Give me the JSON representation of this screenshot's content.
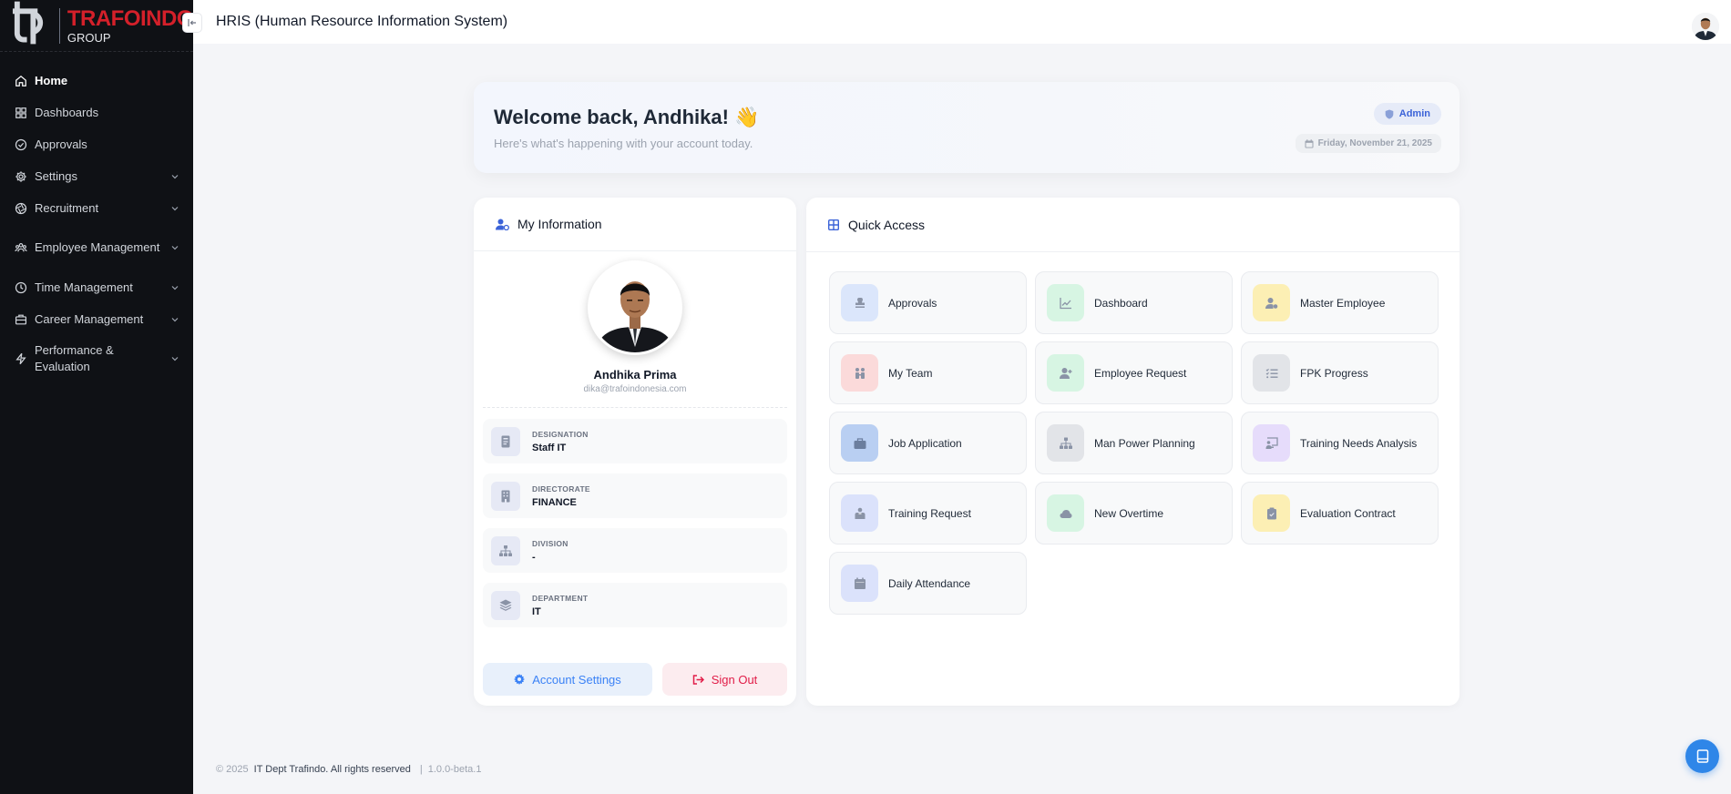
{
  "brand": {
    "name": "TRAFOINDO",
    "sub": "GROUP"
  },
  "header": {
    "title": "HRIS (Human Resource Information System)"
  },
  "sidebar": {
    "items": [
      {
        "label": "Home",
        "icon": "home-icon",
        "active": true,
        "expandable": false
      },
      {
        "label": "Dashboards",
        "icon": "grid-icon",
        "active": false,
        "expandable": false
      },
      {
        "label": "Approvals",
        "icon": "check-circle-icon",
        "active": false,
        "expandable": false
      },
      {
        "label": "Settings",
        "icon": "gear-icon",
        "active": false,
        "expandable": true
      },
      {
        "label": "Recruitment",
        "icon": "aperture-icon",
        "active": false,
        "expandable": true
      },
      {
        "label": "Employee Management",
        "icon": "users-icon",
        "active": false,
        "expandable": true
      },
      {
        "label": "Time Management",
        "icon": "clock-icon",
        "active": false,
        "expandable": true
      },
      {
        "label": "Career Management",
        "icon": "briefcase-icon",
        "active": false,
        "expandable": true
      },
      {
        "label": "Performance & Evaluation",
        "icon": "lightning-icon",
        "active": false,
        "expandable": true
      }
    ]
  },
  "welcome": {
    "title": "Welcome back, Andhika! 👋",
    "subtitle": "Here's what's happening with your account today.",
    "role": "Admin",
    "date": "Friday, November 21, 2025"
  },
  "my_info": {
    "title": "My Information",
    "name": "Andhika Prima",
    "email": "dika@trafoindonesia.com",
    "fields": [
      {
        "label": "DESIGNATION",
        "value": "Staff IT",
        "icon": "id-badge-icon"
      },
      {
        "label": "DIRECTORATE",
        "value": "FINANCE",
        "icon": "building-icon"
      },
      {
        "label": "DIVISION",
        "value": "-",
        "icon": "sitemap-icon"
      },
      {
        "label": "DEPARTMENT",
        "value": "IT",
        "icon": "layers-icon"
      }
    ],
    "account_settings_label": "Account Settings",
    "sign_out_label": "Sign Out"
  },
  "quick_access": {
    "title": "Quick Access",
    "items": [
      {
        "label": "Approvals",
        "icon": "stamp-icon",
        "bg": "#dbe6fb",
        "fg": "#8a93a6"
      },
      {
        "label": "Dashboard",
        "icon": "chart-line-icon",
        "bg": "#d7f5e3",
        "fg": "#8a93a6"
      },
      {
        "label": "Master Employee",
        "icon": "user-gear-icon",
        "bg": "#fcefb4",
        "fg": "#8a93a6"
      },
      {
        "label": "My Team",
        "icon": "people-icon",
        "bg": "#fbdada",
        "fg": "#8a93a6"
      },
      {
        "label": "Employee Request",
        "icon": "user-plus-icon",
        "bg": "#d7f5e3",
        "fg": "#8a93a6"
      },
      {
        "label": "FPK Progress",
        "icon": "list-check-icon",
        "bg": "#e2e4e8",
        "fg": "#8a93a6"
      },
      {
        "label": "Job Application",
        "icon": "briefcase-icon",
        "bg": "#b9cff2",
        "fg": "#6b7e9e"
      },
      {
        "label": "Man Power Planning",
        "icon": "sitemap-icon",
        "bg": "#e2e4e8",
        "fg": "#8a93a6"
      },
      {
        "label": "Training Needs Analysis",
        "icon": "chalkboard-icon",
        "bg": "#e6dcfb",
        "fg": "#8a93a6"
      },
      {
        "label": "Training Request",
        "icon": "teacher-icon",
        "bg": "#dbe2fb",
        "fg": "#8a93a6"
      },
      {
        "label": "New Overtime",
        "icon": "clock-cloud-icon",
        "bg": "#d7f5e3",
        "fg": "#8a93a6"
      },
      {
        "label": "Evaluation Contract",
        "icon": "clipboard-icon",
        "bg": "#fcefb4",
        "fg": "#8a93a6"
      },
      {
        "label": "Daily Attendance",
        "icon": "calendar-check-icon",
        "bg": "#dbe2fb",
        "fg": "#8a93a6"
      }
    ]
  },
  "footer": {
    "copyright": "© 2025",
    "company": "IT Dept Trafindo. All rights reserved",
    "version": "1.0.0-beta.1"
  },
  "colors": {
    "sidebar_bg": "#0f1115",
    "brand_red": "#d4202a",
    "accent_blue": "#3b63d8",
    "danger": "#e11d48"
  }
}
